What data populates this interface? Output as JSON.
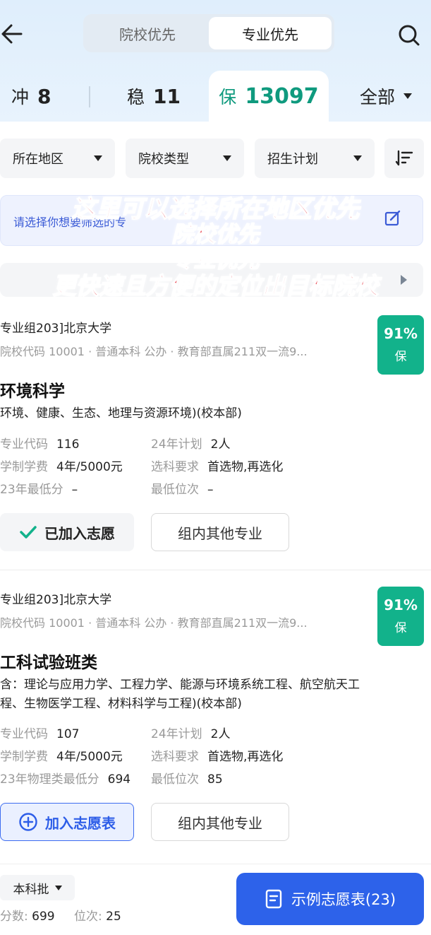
{
  "header": {
    "segments": [
      {
        "label": "院校优先",
        "active": false
      },
      {
        "label": "专业优先",
        "active": true
      }
    ]
  },
  "tabs": [
    {
      "label": "冲",
      "count": "8"
    },
    {
      "label": "稳",
      "count": "11"
    },
    {
      "label": "保",
      "count": "13097",
      "active": true
    },
    {
      "label": "全部"
    }
  ],
  "filters": [
    "所在地区",
    "院校类型",
    "招生计划"
  ],
  "notice": {
    "text": "请选择你想要筛选的专"
  },
  "overlay": {
    "lines": [
      "这里可以选择所在地区优先",
      "院校优先",
      "专业优先",
      "更快速且方便的定位出目标院校"
    ]
  },
  "cards": [
    {
      "group": "专业组203]北京大学",
      "meta": "院校代码 10001 · 普通本科 公办 · 教育部直属211双一流9...",
      "badge": {
        "pct": "91%",
        "level": "保"
      },
      "major": "环境科学",
      "desc": "环境、健康、生态、地理与资源环境)(校本部)",
      "kv": [
        {
          "k": "专业代码",
          "v": "116"
        },
        {
          "k": "24年计划",
          "v": "2人"
        },
        {
          "k": "学制学费",
          "v": "4年/5000元"
        },
        {
          "k": "选科要求",
          "v": "首选物,再选化"
        },
        {
          "k": "23年最低分",
          "v": "–"
        },
        {
          "k": "最低位次",
          "v": "–"
        }
      ],
      "primary_btn": "已加入志愿",
      "other_btn": "组内其他专业"
    },
    {
      "group": "专业组203]北京大学",
      "meta": "院校代码 10001 · 普通本科 公办 · 教育部直属211双一流9...",
      "badge": {
        "pct": "91%",
        "level": "保"
      },
      "major": "工科试验班类",
      "desc": "含：理论与应用力学、工程力学、能源与环境系统工程、航空航天工程、生物医学工程、材料科学与工程)(校本部)",
      "kv": [
        {
          "k": "专业代码",
          "v": "107"
        },
        {
          "k": "24年计划",
          "v": "2人"
        },
        {
          "k": "学制学费",
          "v": "4年/5000元"
        },
        {
          "k": "选科要求",
          "v": "首选物,再选化"
        },
        {
          "k": "23年物理类最低分",
          "v": "694"
        },
        {
          "k": "最低位次",
          "v": "85"
        }
      ],
      "primary_btn": "加入志愿表",
      "other_btn": "组内其他专业"
    }
  ],
  "bottom": {
    "batch": "本科批",
    "score_label": "分数:",
    "score": "699",
    "rank_label": "位次:",
    "rank": "25",
    "cta": "示例志愿表(23)"
  },
  "colors": {
    "accent_green": "#12b28b",
    "primary_blue": "#2d62ea",
    "overlay_red": "#e94d57"
  }
}
